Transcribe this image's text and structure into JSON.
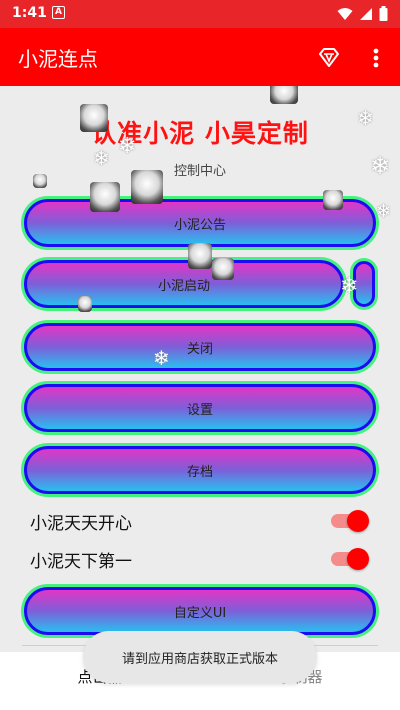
{
  "status_bar": {
    "time": "1:41",
    "notification_glyph": "A",
    "icons": [
      "wifi-icon",
      "signal-icon",
      "battery-icon"
    ]
  },
  "app_bar": {
    "title": "小泥连点",
    "background": "#ff0000",
    "actions": [
      "diamond-icon",
      "more-vert-icon"
    ]
  },
  "main": {
    "headline": "认准小泥  小昊定制",
    "subtitle": "控制中心",
    "buttons": [
      {
        "label": "小泥公告"
      },
      {
        "label": "小泥启动"
      },
      {
        "label": "关闭"
      },
      {
        "label": "设置"
      },
      {
        "label": "存档"
      }
    ],
    "toggles": [
      {
        "label": "小泥天天开心",
        "on": true
      },
      {
        "label": "小泥天下第一",
        "on": true
      }
    ],
    "custom_button": {
      "label": "自定义UI"
    }
  },
  "toast": {
    "text": "请到应用商店获取正式版本"
  },
  "bottom_nav": {
    "tabs": [
      {
        "label": "点击器",
        "active": true
      },
      {
        "label": "录制器",
        "active": false
      }
    ]
  },
  "colors": {
    "accent": "#ff0000",
    "headline": "#ff1212",
    "pill_border": "#1d0cf2",
    "pill_glow": "#44f27e",
    "switch_knob": "#ff0000"
  }
}
